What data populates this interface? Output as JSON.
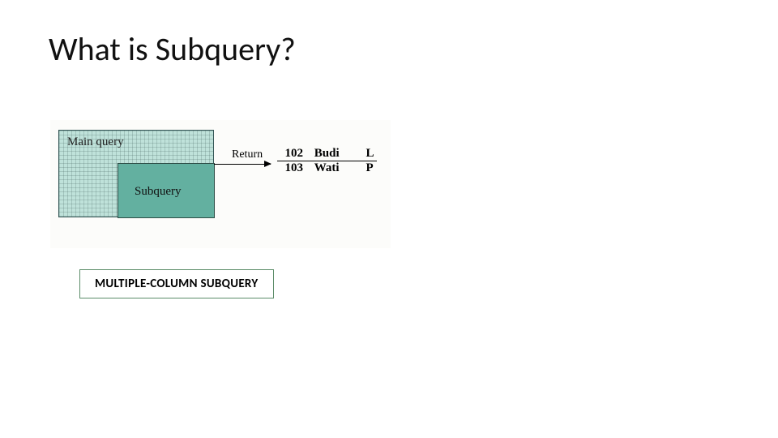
{
  "title": "What is Subquery?",
  "diagram": {
    "main_query_label": "Main query",
    "sub_query_label": "Subquery",
    "return_label": "Return",
    "result_rows": [
      {
        "id": "102",
        "name": "Budi",
        "code": "L"
      },
      {
        "id": "103",
        "name": "Wati",
        "code": "P"
      }
    ]
  },
  "subquery_type_label": "MULTIPLE-COLUMN SUBQUERY"
}
